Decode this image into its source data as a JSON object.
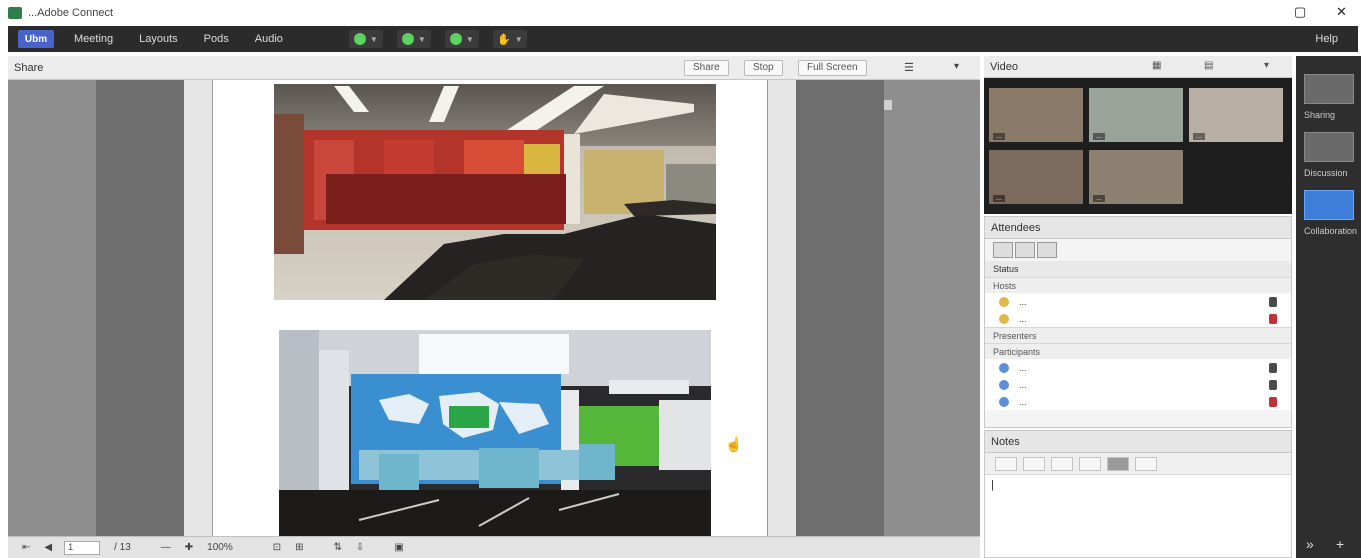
{
  "window": {
    "title": "...Adobe Connect",
    "min_label": "▢",
    "close_label": "✕"
  },
  "menubar": {
    "logo": "Ubm",
    "items": [
      "Meeting",
      "Layouts",
      "Pods",
      "Audio"
    ],
    "help": "Help",
    "tools": [
      "speaker-icon",
      "microphone-icon",
      "webcam-icon",
      "raise-hand-icon"
    ]
  },
  "share_pod": {
    "title": "Share",
    "buttons": [
      "Share",
      "Stop",
      "Full Screen"
    ],
    "footer": {
      "page_value": "1",
      "page_total": "/ 13",
      "zoom": "100%"
    }
  },
  "video_pod": {
    "title": "Video",
    "participants": [
      {
        "name": "...",
        "tone": "#8a7a6a"
      },
      {
        "name": "...",
        "tone": "#9aa39a"
      },
      {
        "name": "...",
        "tone": "#b8b0a4"
      },
      {
        "name": "...",
        "tone": "#7c6a5e"
      },
      {
        "name": "...",
        "tone": "#8c8070"
      }
    ]
  },
  "attendees_pod": {
    "title": "Attendees",
    "status_text": "Status",
    "groups": [
      {
        "label": "Hosts",
        "people": [
          {
            "name": "...",
            "mic": "active",
            "color": "#e1b84a",
            "mic_color": "#4a4a4a"
          },
          {
            "name": "...",
            "mic": "muted",
            "color": "#e1b84a",
            "mic_color": "#c0303a"
          }
        ]
      },
      {
        "label": "Presenters",
        "people": []
      },
      {
        "label": "Participants",
        "people": [
          {
            "name": "...",
            "mic": "active",
            "color": "#5b8fd6",
            "mic_color": "#4a4a4a"
          },
          {
            "name": "...",
            "mic": "active",
            "color": "#5b8fd6",
            "mic_color": "#4a4a4a"
          },
          {
            "name": "...",
            "mic": "muted",
            "color": "#5b8fd6",
            "mic_color": "#c0303a"
          }
        ]
      }
    ]
  },
  "notes_pod": {
    "title": "Notes",
    "content": "|"
  },
  "layouts": {
    "items": [
      {
        "label": "Sharing",
        "active": false
      },
      {
        "label": "Discussion",
        "active": false
      },
      {
        "label": "Collaboration",
        "active": true
      }
    ],
    "add_label": "+",
    "collapse_label": "»"
  },
  "colors": {
    "menubar_bg": "#2b2b2b",
    "accent_blue": "#3d7ed8",
    "green_tool": "#5fd35f"
  }
}
